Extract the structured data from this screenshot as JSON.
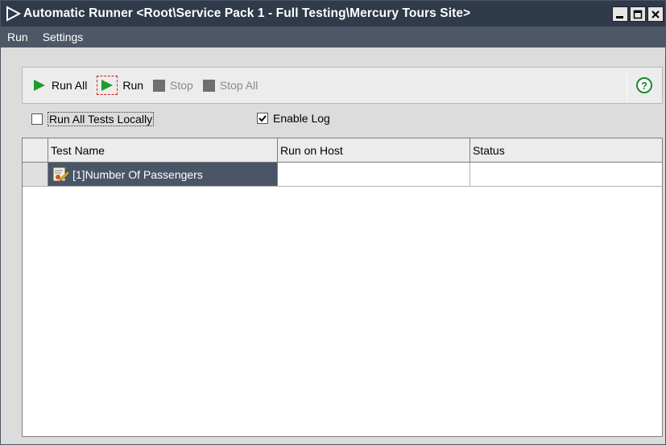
{
  "window": {
    "title": "Automatic Runner <Root\\Service Pack 1 - Full Testing\\Mercury Tours Site>"
  },
  "menu": {
    "items": [
      {
        "label": "Run"
      },
      {
        "label": "Settings"
      }
    ]
  },
  "toolbar": {
    "run_all": "Run All",
    "run": "Run",
    "stop": "Stop",
    "stop_all": "Stop All"
  },
  "options": {
    "run_locally": {
      "label": "Run All Tests Locally",
      "checked": false
    },
    "enable_log": {
      "label": "Enable Log",
      "checked": true
    }
  },
  "grid": {
    "columns": [
      "Test Name",
      "Run on Host",
      "Status"
    ],
    "rows": [
      {
        "test_name": "[1]Number Of Passengers",
        "host": "",
        "status": ""
      }
    ]
  },
  "colors": {
    "title_bar": "#2f3a4a",
    "menu_bar": "#4e5766",
    "selected_cell": "#4a5568",
    "run_green": "#1f9a2e"
  }
}
